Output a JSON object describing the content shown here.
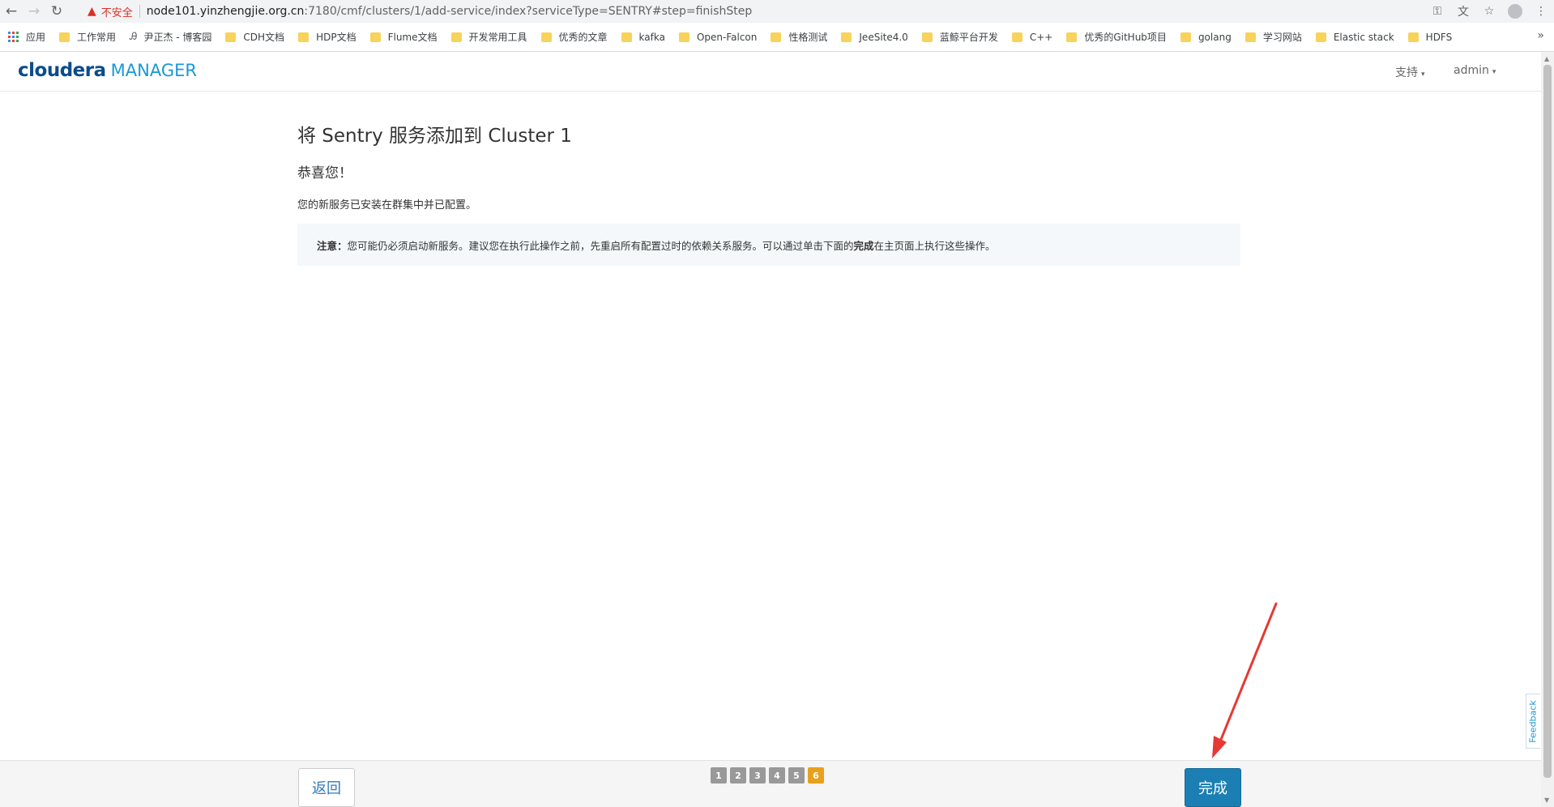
{
  "browser": {
    "back_icon": "←",
    "forward_icon": "→",
    "reload_icon": "↻",
    "warning_icon": "▲",
    "insecure_label": "不安全",
    "url_host": "node101.yinzhengjie.org.cn",
    "url_rest": ":7180/cmf/clusters/1/add-service/index?serviceType=SENTRY#step=finishStep",
    "key_icon": "⚿",
    "translate_icon": "文",
    "star_icon": "☆",
    "menu_icon": "⋮"
  },
  "bookmarks": {
    "apps_label": "应用",
    "items": [
      {
        "label": "工作常用",
        "icon": "folder-icon"
      },
      {
        "label": "尹正杰 - 博客园",
        "icon": "person-icon"
      },
      {
        "label": "CDH文档",
        "icon": "folder-icon"
      },
      {
        "label": "HDP文档",
        "icon": "folder-icon"
      },
      {
        "label": "Flume文档",
        "icon": "folder-icon"
      },
      {
        "label": "开发常用工具",
        "icon": "folder-icon"
      },
      {
        "label": "优秀的文章",
        "icon": "folder-icon"
      },
      {
        "label": "kafka",
        "icon": "folder-icon"
      },
      {
        "label": "Open-Falcon",
        "icon": "folder-icon"
      },
      {
        "label": "性格测试",
        "icon": "folder-icon"
      },
      {
        "label": "JeeSite4.0",
        "icon": "folder-icon"
      },
      {
        "label": "蓝鲸平台开发",
        "icon": "folder-icon"
      },
      {
        "label": "C++",
        "icon": "folder-icon"
      },
      {
        "label": "优秀的GitHub项目",
        "icon": "folder-icon"
      },
      {
        "label": "golang",
        "icon": "folder-icon"
      },
      {
        "label": "学习网站",
        "icon": "folder-icon"
      },
      {
        "label": "Elastic stack",
        "icon": "folder-icon"
      },
      {
        "label": "HDFS",
        "icon": "folder-icon"
      }
    ],
    "more_label": "»"
  },
  "header": {
    "logo_main": "cloudera",
    "logo_sub": "MANAGER",
    "support_label": "支持",
    "user_label": "admin",
    "caret": "▾"
  },
  "main": {
    "title": "将 Sentry 服务添加到 Cluster 1",
    "congrats": "恭喜您！",
    "description": "您的新服务已安装在群集中并已配置。",
    "note_label": "注意：",
    "note_text_1": "您可能仍必须启动新服务。建议您在执行此操作之前，先重启所有配置过时的依赖关系服务。可以通过单击下面的",
    "note_bold": "完成",
    "note_text_2": "在主页面上执行这些操作。"
  },
  "feedback_label": "Feedback",
  "footer": {
    "back_label": "返回",
    "finish_label": "完成",
    "steps": [
      "1",
      "2",
      "3",
      "4",
      "5",
      "6"
    ],
    "active_step": "6"
  },
  "colors": {
    "accent": "#1b7fb3",
    "active_step": "#e7a11d",
    "annotation": "#e53935"
  }
}
